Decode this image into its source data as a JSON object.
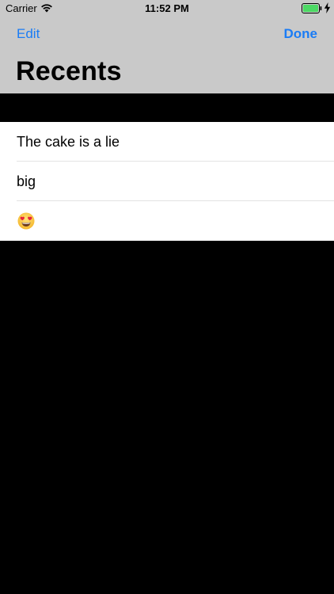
{
  "status_bar": {
    "carrier": "Carrier",
    "time": "11:52 PM",
    "wifi_icon": "wifi-icon",
    "battery_icon": "battery-icon",
    "charging_icon": "charging-bolt-icon",
    "battery_level": 1.0
  },
  "nav": {
    "edit_label": "Edit",
    "done_label": "Done",
    "title": "Recents"
  },
  "recents": [
    {
      "text": "The cake is a lie"
    },
    {
      "text": "big"
    },
    {
      "text": "",
      "icon": "heart-eyes-emoji-icon"
    }
  ],
  "colors": {
    "accent": "#1a7cf5",
    "header_background": "#c9c9c9",
    "page_background": "#000000",
    "list_background": "#ffffff",
    "battery_fill": "#4cd964"
  }
}
